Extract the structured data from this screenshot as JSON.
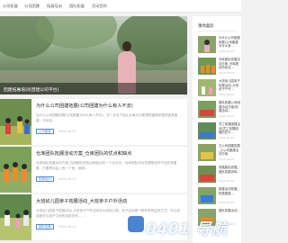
{
  "nav": {
    "items": [
      "公司拓展",
      "公司团建",
      "拓展培训",
      "团队拓展",
      "活动百科"
    ]
  },
  "hero": {
    "caption": "团建拓展培训(团建公司平台)"
  },
  "articles": [
    {
      "title": "为什么公司团建拓展(公司团建为什么有人不去)",
      "excerpt": "为什么公司团建拓展(公司团建为什么有人不去)，在一天当下较企业每天为更是搭建更积极的家具团建，冲动活...",
      "tag": "公司团建",
      "date": "2024-08-23"
    },
    {
      "title": "仓库团队拓展活动方案_仓库团队的优点和缺点",
      "excerpt": "仓库团队拓展活动方案_仓库团队的优点和缺点在一个企业中，仓库团队作为资源物流环节还非常重要，只要搞活会上有一个良，我明...",
      "tag": "拓展培训",
      "date": "2024-08-23"
    },
    {
      "title": "大班幼儿园亲子拓展活动_大班亲子户外活动",
      "excerpt": "大班幼儿园亲子拓展活动_大班亲子户外活动在大班幼儿园，亲子活动是一种非常有益的方式，可以加强家长与孩子之间的亲密关系，...",
      "tag": "团队拓展",
      "date": "2024-08-23"
    }
  ],
  "sidebar": {
    "heading": "猜你喜欢",
    "items": [
      {
        "title": "为什么公司团建拓展(公司团建为什么有...",
        "date": "2024-08-23"
      },
      {
        "title": "仓库团队拓展活动方案_仓库团队的优点...",
        "date": "2024-08-23"
      },
      {
        "title": "大班幼儿园亲子拓展活动_大班亲子户外...",
        "date": "2024-08-23"
      },
      {
        "title": "团队拓展公司团建活动方案(拓展活动...",
        "date": "2024-08-23"
      },
      {
        "title": "员工拓展团建活动(员工拓展团建的意义...",
        "date": "2024-08-23"
      },
      {
        "title": "五公司团建拓展_小公司团建活动方案",
        "date": "2024-08-23"
      },
      {
        "title": "安踏团队拓展_团队拓展训练...",
        "date": "2024-08-23"
      },
      {
        "title": "团建活动拓展_拓展团建...",
        "date": "2024-08-23"
      },
      {
        "title": "团队拓展活动...",
        "date": "2024-08-23"
      },
      {
        "title": "拓展培训...",
        "date": "2024-08-23"
      }
    ]
  },
  "watermark": {
    "brand": "0401 导航",
    "sub": "www.0401.net"
  },
  "colors": {
    "accent": "#4a90d9",
    "nav_bg": "#ffffff",
    "page_bg": "#f2f2f2"
  }
}
